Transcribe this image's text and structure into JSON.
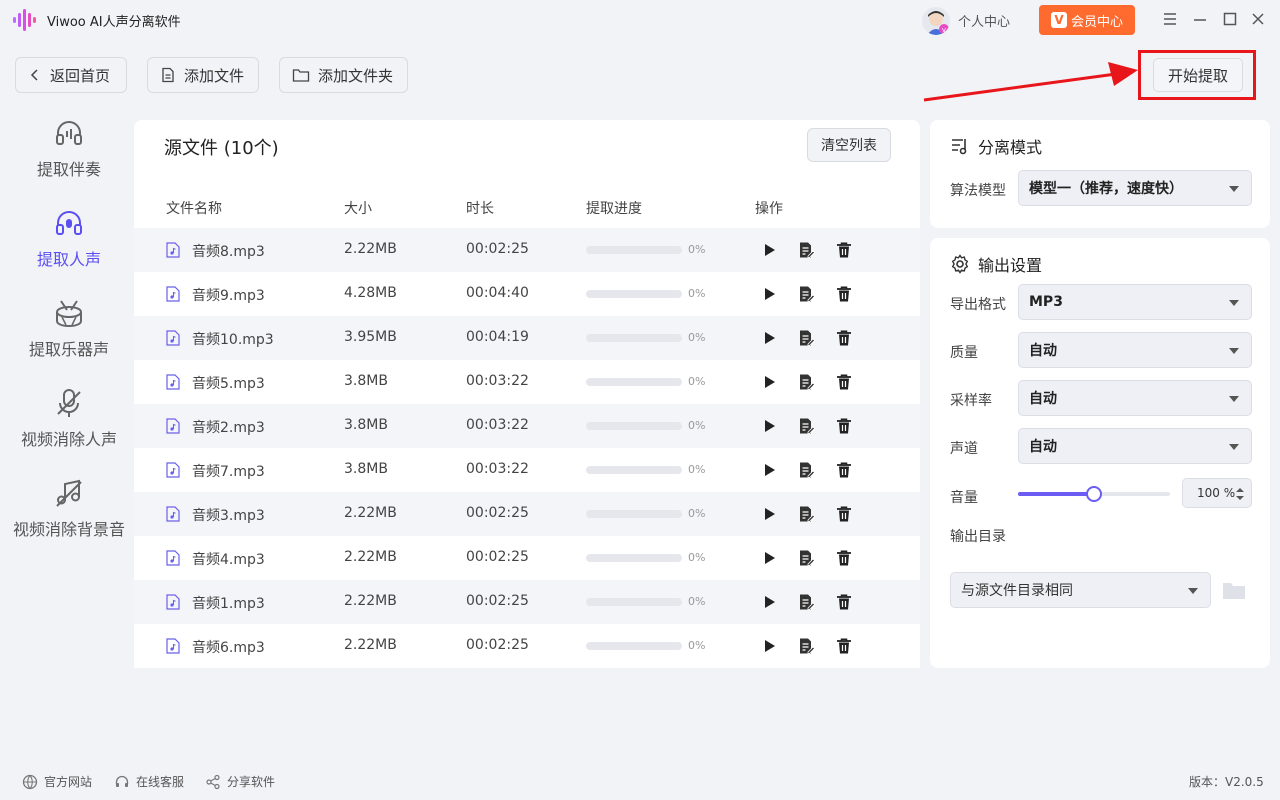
{
  "app": {
    "title": "Viwoo AI人声分离软件"
  },
  "header": {
    "user_center": "个人中心",
    "vip_center": "会员中心",
    "vip_badge": "V"
  },
  "toolbar": {
    "back": "返回首页",
    "add_file": "添加文件",
    "add_folder": "添加文件夹",
    "start": "开始提取"
  },
  "nav": [
    {
      "label": "提取伴奏",
      "icon": "headphones-icon"
    },
    {
      "label": "提取人声",
      "icon": "headset-mic-icon",
      "active": true
    },
    {
      "label": "提取乐器声",
      "icon": "drum-icon"
    },
    {
      "label": "视频消除人声",
      "icon": "mic-off-icon"
    },
    {
      "label": "视频消除背景音",
      "icon": "music-off-icon"
    }
  ],
  "files": {
    "title": "源文件 (10个)",
    "clear": "清空列表",
    "headers": {
      "name": "文件名称",
      "size": "大小",
      "duration": "时长",
      "progress": "提取进度",
      "actions": "操作"
    },
    "rows": [
      {
        "name": "音频8.mp3",
        "size": "2.22MB",
        "duration": "00:02:25",
        "progress": "0%",
        "progress_value": 0
      },
      {
        "name": "音频9.mp3",
        "size": "4.28MB",
        "duration": "00:04:40",
        "progress": "0%",
        "progress_value": 0
      },
      {
        "name": "音频10.mp3",
        "size": "3.95MB",
        "duration": "00:04:19",
        "progress": "0%",
        "progress_value": 0
      },
      {
        "name": "音频5.mp3",
        "size": "3.8MB",
        "duration": "00:03:22",
        "progress": "0%",
        "progress_value": 0
      },
      {
        "name": "音频2.mp3",
        "size": "3.8MB",
        "duration": "00:03:22",
        "progress": "0%",
        "progress_value": 0
      },
      {
        "name": "音频7.mp3",
        "size": "3.8MB",
        "duration": "00:03:22",
        "progress": "0%",
        "progress_value": 0
      },
      {
        "name": "音频3.mp3",
        "size": "2.22MB",
        "duration": "00:02:25",
        "progress": "0%",
        "progress_value": 0
      },
      {
        "name": "音频4.mp3",
        "size": "2.22MB",
        "duration": "00:02:25",
        "progress": "0%",
        "progress_value": 0
      },
      {
        "name": "音频1.mp3",
        "size": "2.22MB",
        "duration": "00:02:25",
        "progress": "0%",
        "progress_value": 0
      },
      {
        "name": "音频6.mp3",
        "size": "2.22MB",
        "duration": "00:02:25",
        "progress": "0%",
        "progress_value": 0
      }
    ]
  },
  "separation": {
    "title": "分离模式",
    "model_label": "算法模型",
    "model_value": "模型一（推荐，速度快）"
  },
  "output": {
    "title": "输出设置",
    "format_label": "导出格式",
    "format_value": "MP3",
    "quality_label": "质量",
    "quality_value": "自动",
    "samplerate_label": "采样率",
    "samplerate_value": "自动",
    "channel_label": "声道",
    "channel_value": "自动",
    "volume_label": "音量",
    "volume_text": "100 %",
    "volume_fraction": 0.5,
    "dir_label": "输出目录",
    "dir_value": "与源文件目录相同"
  },
  "footer": {
    "website": "官方网站",
    "support": "在线客服",
    "share": "分享软件",
    "version": "版本：V2.0.5"
  },
  "colors": {
    "accent": "#5b4ff2",
    "vip": "#ff6a2f",
    "highlight": "#e8161b"
  }
}
